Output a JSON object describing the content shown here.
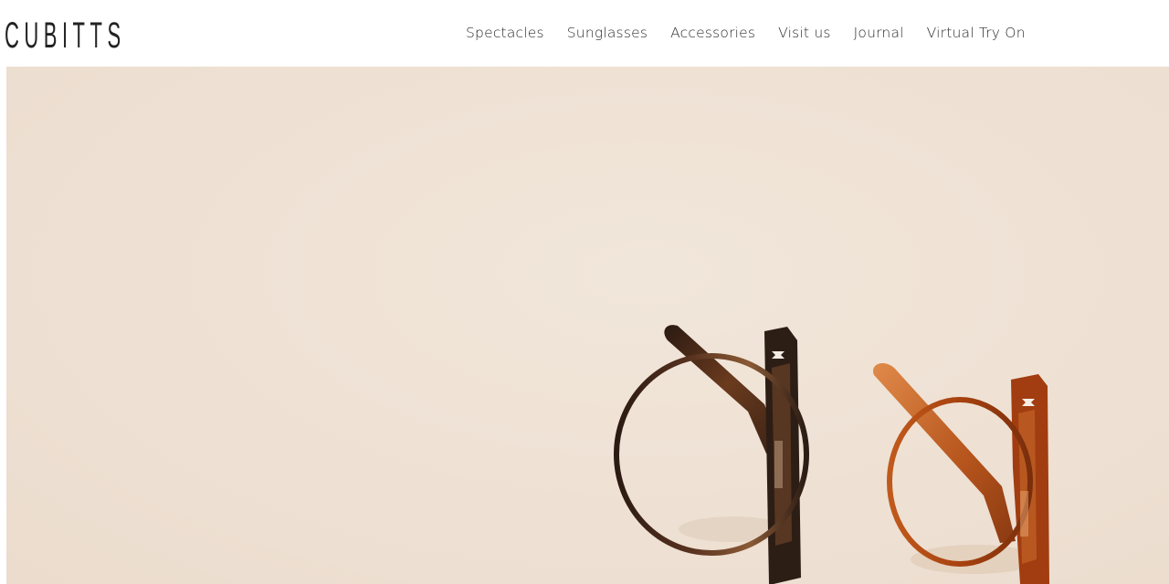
{
  "brand": {
    "logo_text": "CUBITTS"
  },
  "nav": {
    "items": [
      {
        "label": "Spectacles"
      },
      {
        "label": "Sunglasses"
      },
      {
        "label": "Accessories"
      },
      {
        "label": "Visit us"
      },
      {
        "label": "Journal"
      },
      {
        "label": "Virtual Try On"
      }
    ]
  },
  "hero": {
    "background_color": "#efe2d5",
    "image_subject": "two pairs of round glasses, dark tortoise and amber, lying folded on a cream backdrop"
  }
}
